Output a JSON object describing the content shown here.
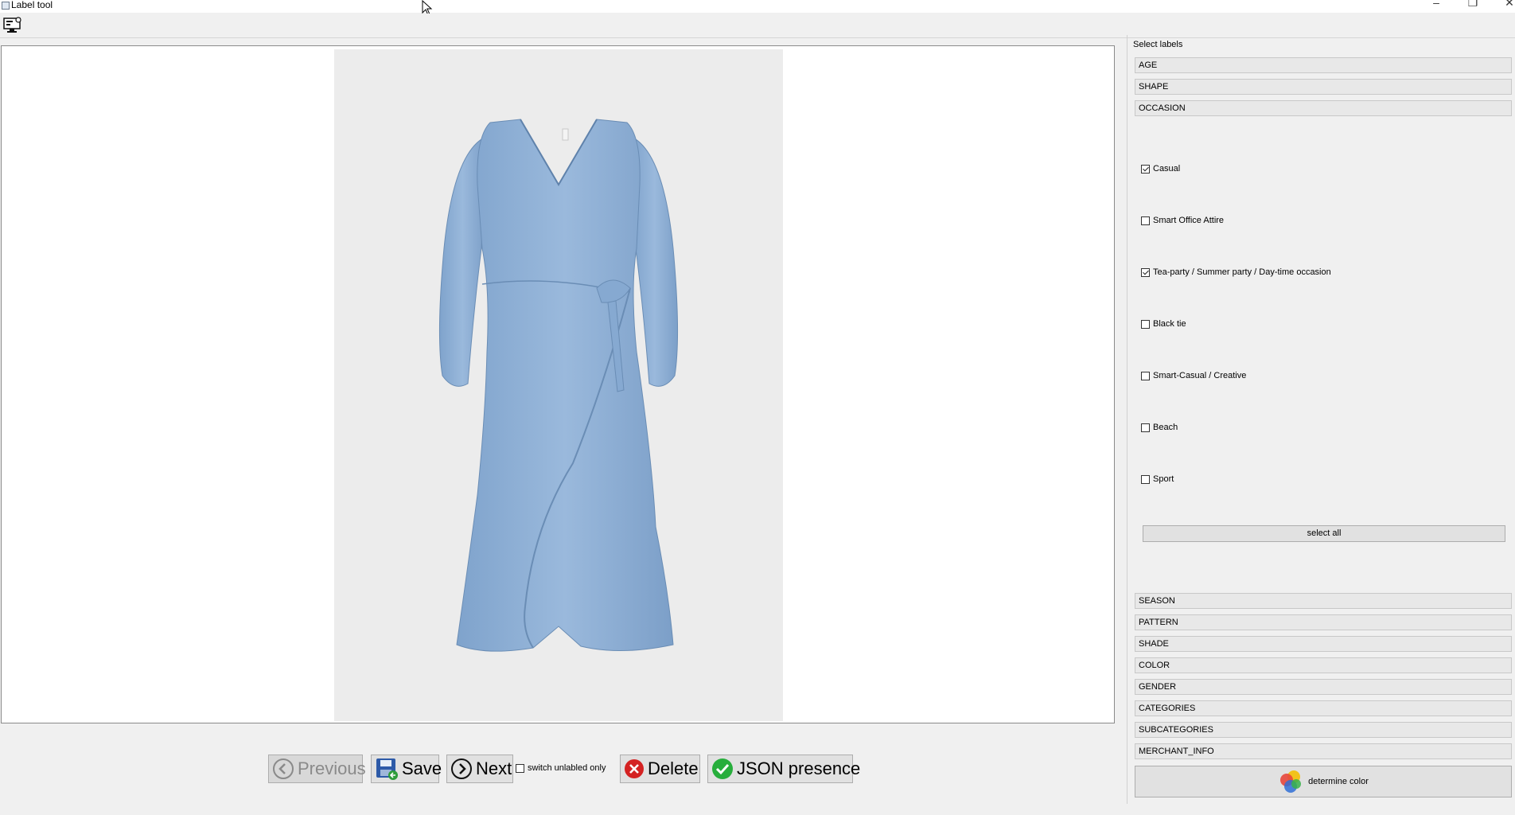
{
  "window": {
    "title": "Label tool",
    "controls": [
      "–",
      "❐",
      "✕"
    ]
  },
  "bottom_bar": {
    "previous": "Previous",
    "save": "Save",
    "next": "Next",
    "switch_unlabeled": "switch unlabled only",
    "delete": "Delete",
    "json": "JSON presence"
  },
  "right_panel": {
    "heading": "Select labels",
    "top_categories": [
      "AGE",
      "SHAPE",
      "OCCASION"
    ],
    "occasion_options": [
      {
        "label": "Casual",
        "checked": true
      },
      {
        "label": "Smart Office Attire",
        "checked": false
      },
      {
        "label": "Tea-party / Summer party / Day-time occasion",
        "checked": true
      },
      {
        "label": "Black tie",
        "checked": false
      },
      {
        "label": "Smart-Casual / Creative",
        "checked": false
      },
      {
        "label": "Beach",
        "checked": false
      },
      {
        "label": "Sport",
        "checked": false
      }
    ],
    "select_all": "select all",
    "bottom_categories": [
      "SEASON",
      "PATTERN",
      "SHADE",
      "COLOR",
      "GENDER",
      "CATEGORIES",
      "SUBCATEGORIES",
      "MERCHANT_INFO"
    ],
    "determine_color": "determine color"
  },
  "colors": {
    "dress": "#8fb1d6",
    "accent_ok": "#27ae3c",
    "accent_delete": "#d42222"
  }
}
